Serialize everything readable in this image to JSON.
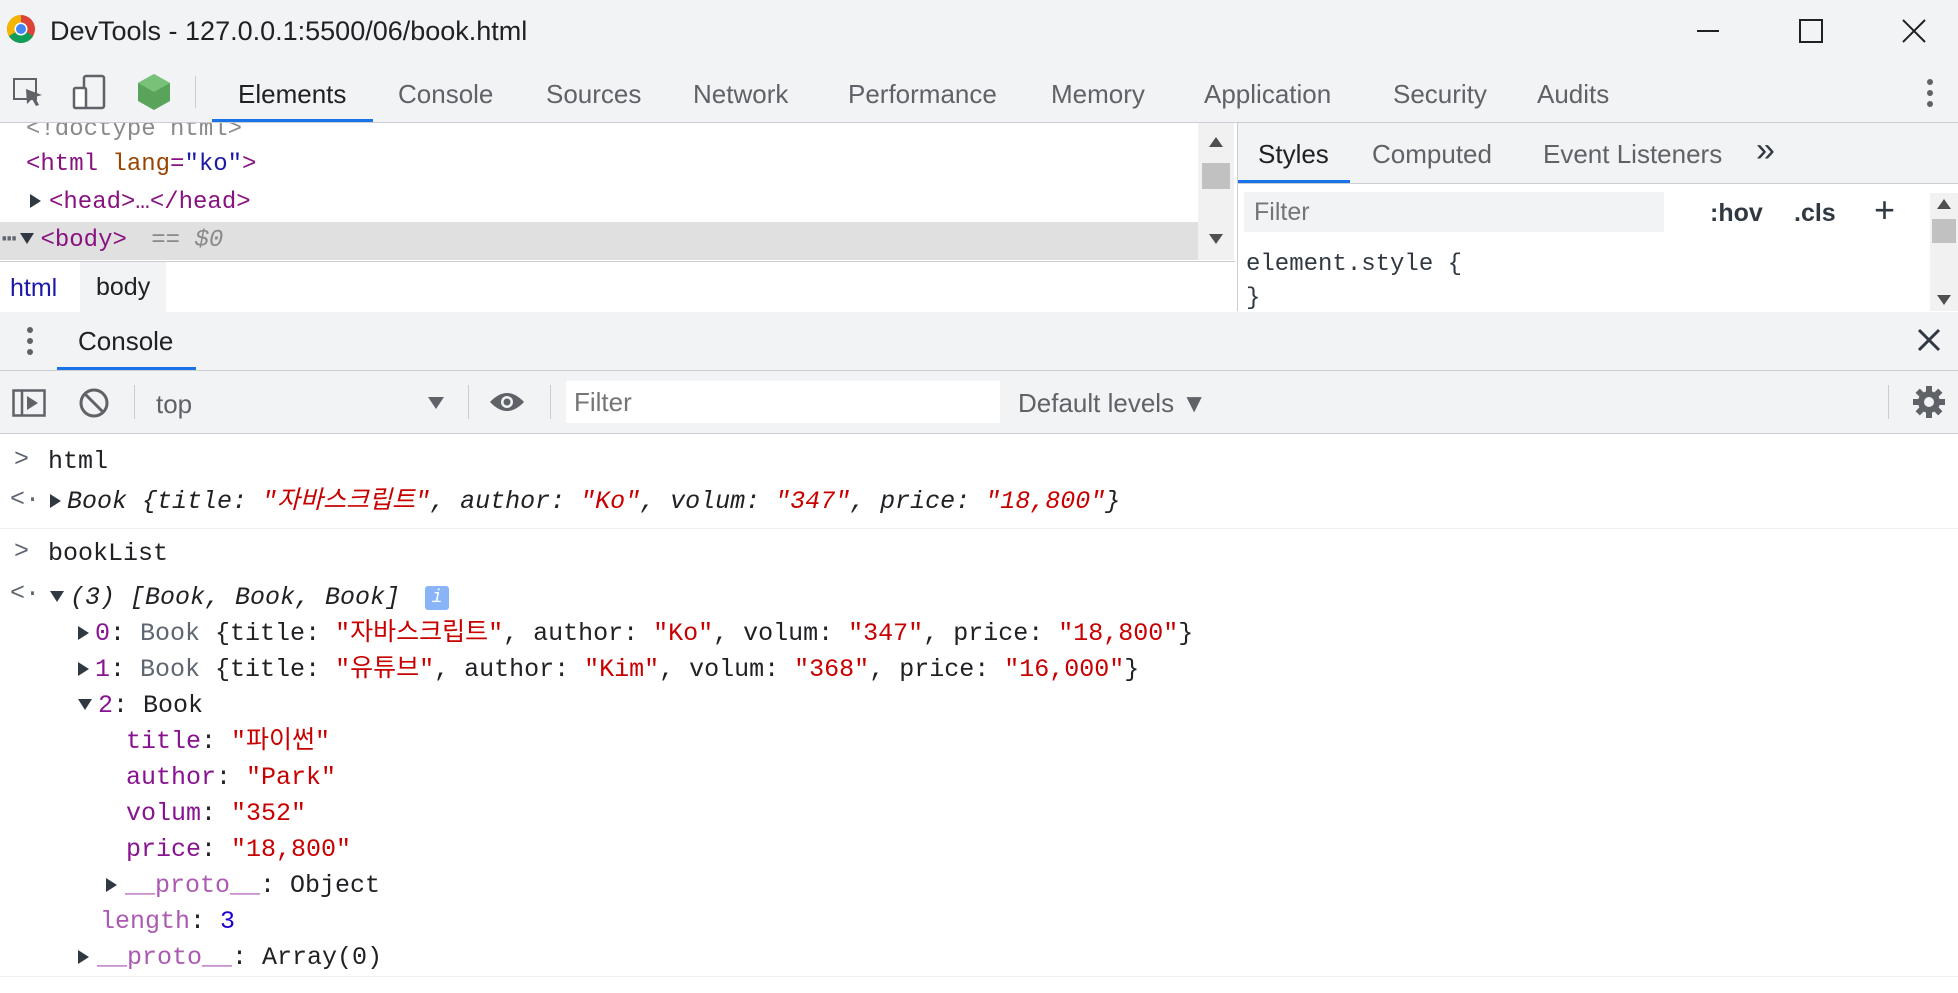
{
  "window": {
    "title": "DevTools - 127.0.0.1:5500/06/book.html"
  },
  "main_tabs": [
    "Elements",
    "Console",
    "Sources",
    "Network",
    "Performance",
    "Memory",
    "Application",
    "Security",
    "Audits"
  ],
  "elements": {
    "doctype": "<!doctype html>",
    "html_open": "<html",
    "html_attr": "lang",
    "html_eq": "=",
    "html_val": "\"ko\"",
    "html_close": ">",
    "head": "<head>…</head>",
    "body": "<body>",
    "body_ref": "== $0",
    "breadcrumb": [
      "html",
      "body"
    ]
  },
  "styles": {
    "tabs": [
      "Styles",
      "Computed",
      "Event Listeners"
    ],
    "more": "»",
    "filter_placeholder": "Filter",
    "hov": ":hov",
    "cls": ".cls",
    "plus": "+",
    "element_style": "element.style {",
    "brace_close": "}"
  },
  "drawer": {
    "tab": "Console"
  },
  "console_toolbar": {
    "context": "top",
    "filter_placeholder": "Filter",
    "levels": "Default levels ▼"
  },
  "log": {
    "in1": "html",
    "out1": {
      "prefix": "Book {title: ",
      "title": "\"자바스크립트\"",
      "author_k": ", author: ",
      "author": "\"Ko\"",
      "volum_k": ", volum: ",
      "volum": "\"347\"",
      "price_k": ", price: ",
      "price": "\"18,800\"",
      "suffix": "}"
    },
    "in2": "bookList",
    "out2_header": "(3) [Book, Book, Book]",
    "info_badge": "i",
    "item0": {
      "idx": "0",
      "label": "Book",
      "prefix": " {title: ",
      "title": "\"자바스크립트\"",
      "author_k": ", author: ",
      "author": "\"Ko\"",
      "volum_k": ", volum: ",
      "volum": "\"347\"",
      "price_k": ", price: ",
      "price": "\"18,800\"",
      "suffix": "}"
    },
    "item1": {
      "idx": "1",
      "label": "Book",
      "prefix": " {title: ",
      "title": "\"유튜브\"",
      "author_k": ", author: ",
      "author": "\"Kim\"",
      "volum_k": ", volum: ",
      "volum": "\"368\"",
      "price_k": ", price: ",
      "price": "\"16,000\"",
      "suffix": "}"
    },
    "item2": {
      "idx": "2",
      "label": "Book"
    },
    "props": [
      {
        "k": "title",
        "v": "\"파이썬\""
      },
      {
        "k": "author",
        "v": "\"Park\""
      },
      {
        "k": "volum",
        "v": "\"352\""
      },
      {
        "k": "price",
        "v": "\"18,800\""
      }
    ],
    "proto_obj_k": "__proto__",
    "proto_obj_v": "Object",
    "length_k": "length",
    "length_v": "3",
    "proto_arr_k": "__proto__",
    "proto_arr_v": "Array(0)",
    "colon": ": "
  },
  "colors": {
    "accent": "#1a73e8",
    "string": "#c80000",
    "key": "#881391",
    "number": "#1c00cf"
  }
}
